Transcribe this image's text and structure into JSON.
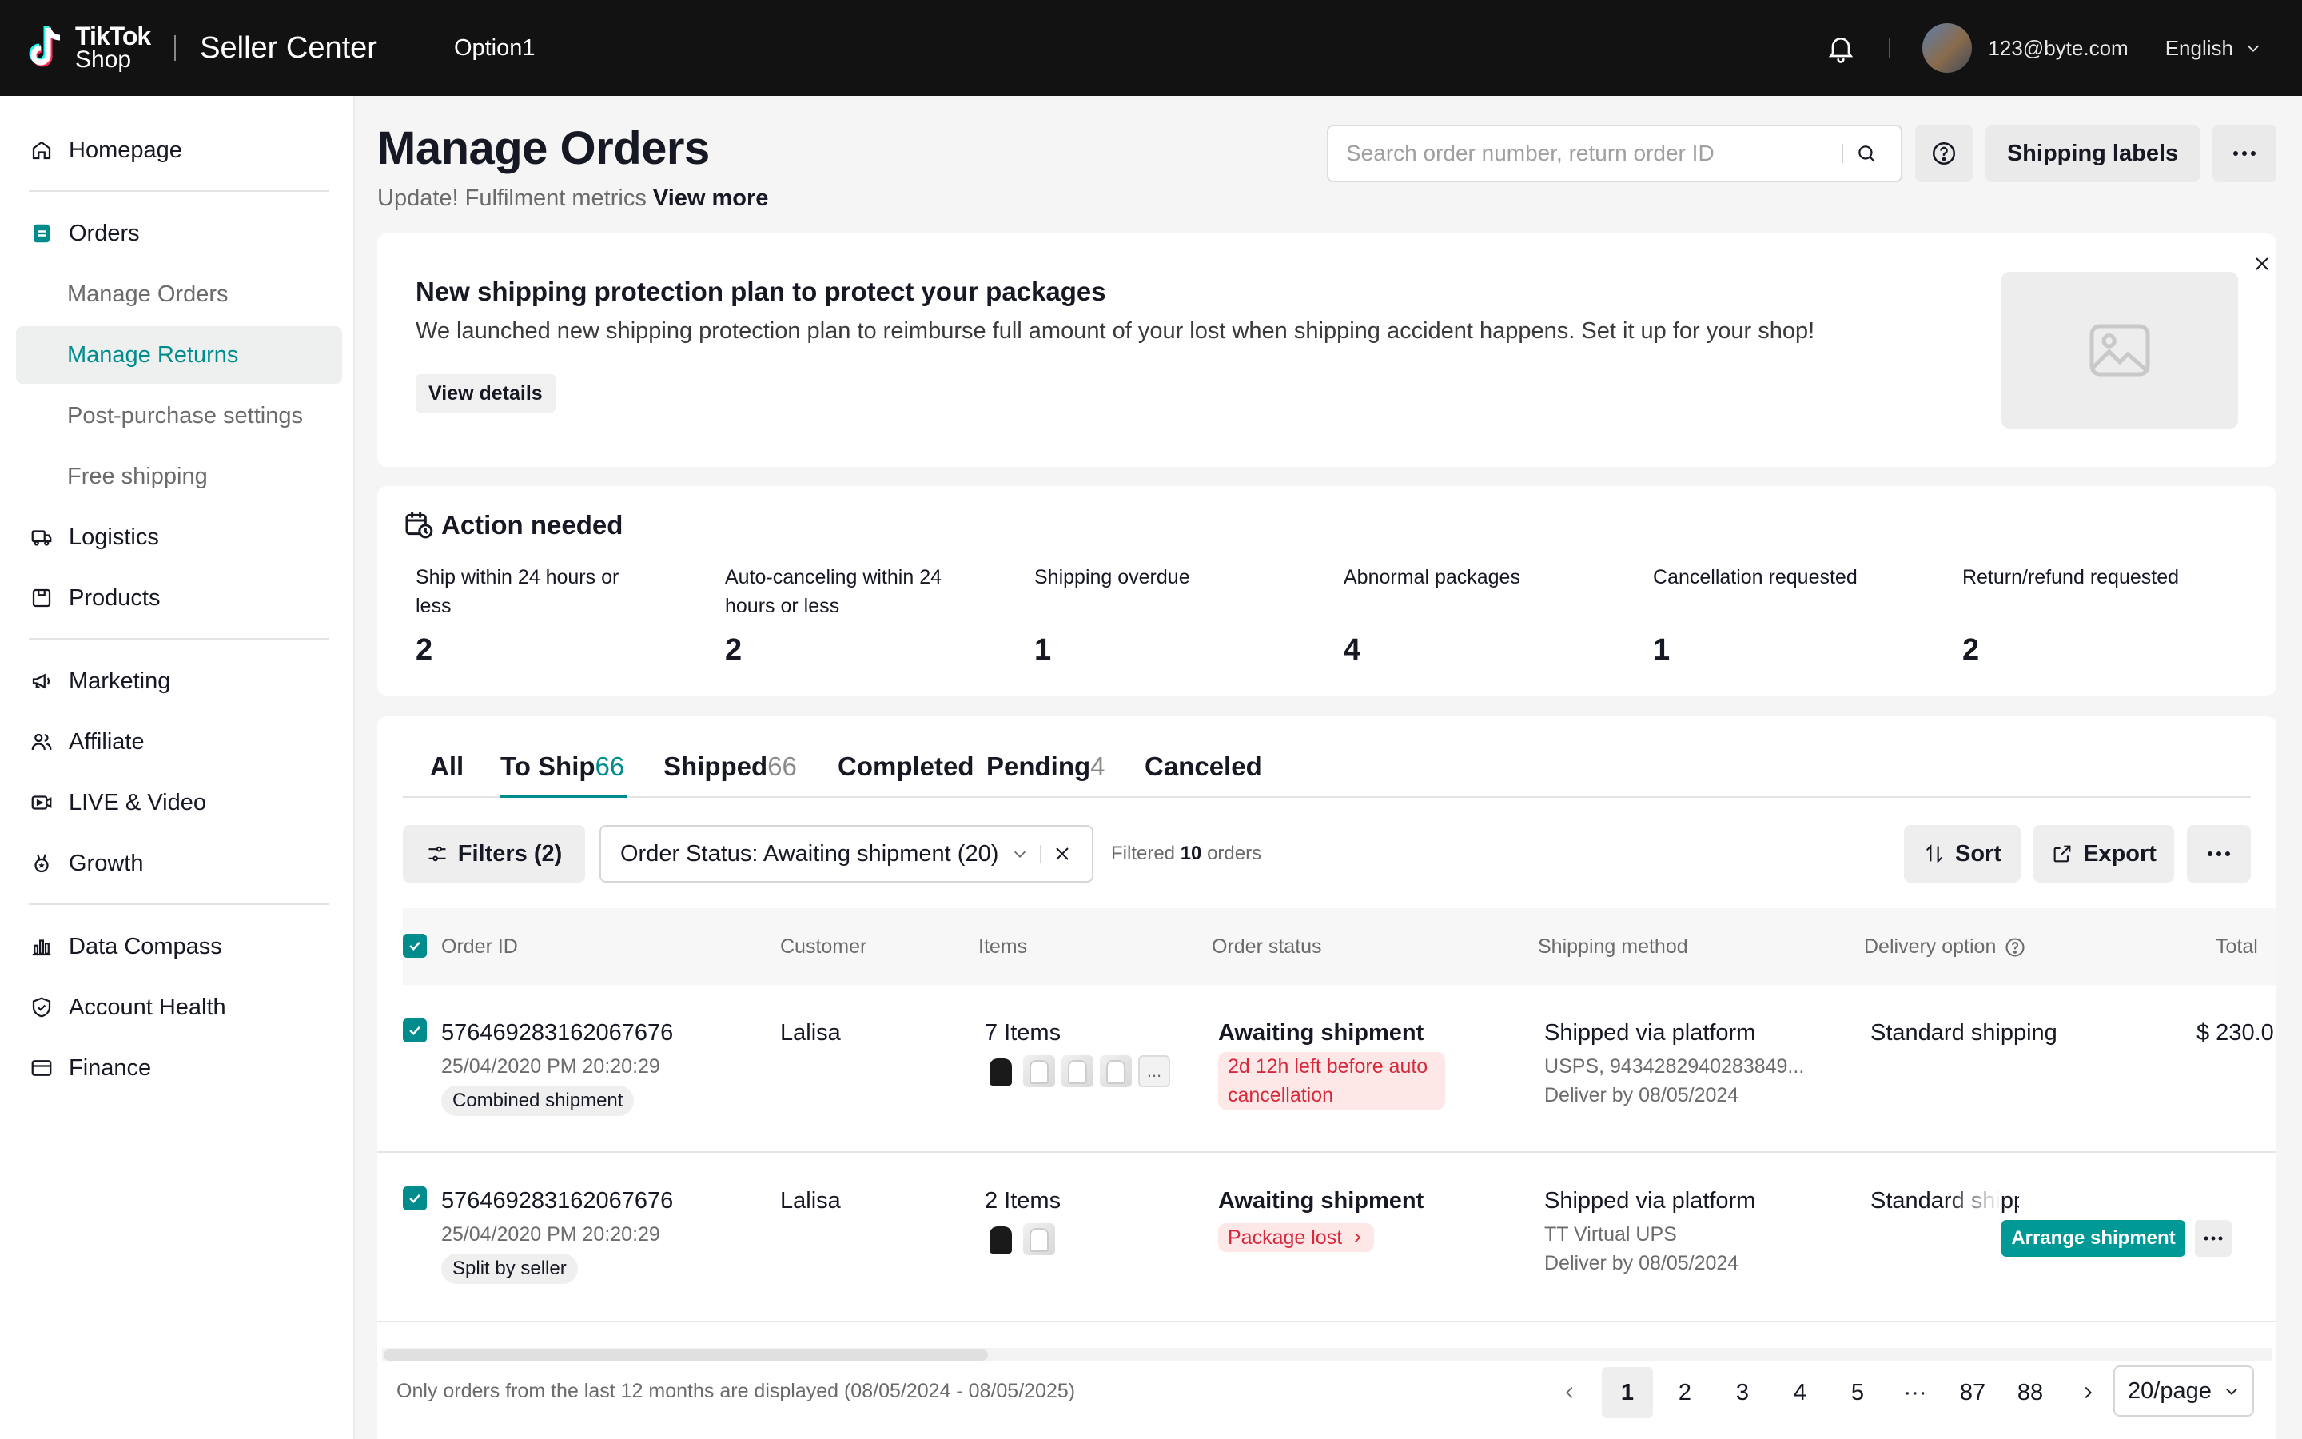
{
  "topbar": {
    "brand_line1": "TikTok",
    "brand_line2": "Shop",
    "product_name": "Seller Center",
    "option": "Option1",
    "user_email": "123@byte.com",
    "language": "English"
  },
  "sidebar": {
    "items": [
      {
        "label": "Homepage",
        "icon": "home-icon"
      },
      {
        "label": "Orders",
        "icon": "orders-icon"
      },
      {
        "label": "Manage Orders",
        "sub": true
      },
      {
        "label": "Manage Returns",
        "sub": true,
        "active": true
      },
      {
        "label": "Post-purchase settings",
        "sub": true
      },
      {
        "label": "Free shipping",
        "sub": true
      },
      {
        "label": "Logistics",
        "icon": "truck-icon"
      },
      {
        "label": "Products",
        "icon": "box-icon"
      },
      {
        "label": "Marketing",
        "icon": "megaphone-icon"
      },
      {
        "label": "Affiliate",
        "icon": "people-icon"
      },
      {
        "label": "LIVE & Video",
        "icon": "video-icon"
      },
      {
        "label": "Growth",
        "icon": "medal-icon"
      },
      {
        "label": "Data Compass",
        "icon": "bar-chart-icon"
      },
      {
        "label": "Account Health",
        "icon": "shield-icon"
      },
      {
        "label": "Finance",
        "icon": "card-icon"
      }
    ]
  },
  "header": {
    "title": "Manage Orders",
    "subtitle": "Update! Fulfilment metrics",
    "subtitle_link": "View more",
    "search_placeholder": "Search order number, return order ID",
    "shipping_labels": "Shipping labels"
  },
  "banner": {
    "title": "New shipping protection plan to protect your packages",
    "description": "We launched new shipping protection plan to reimburse full amount of your lost when shipping accident happens. Set it up for your shop!",
    "button": "View details"
  },
  "action_needed": {
    "title": "Action needed",
    "metrics": [
      {
        "label": "Ship within 24 hours or less",
        "value": "2"
      },
      {
        "label": "Auto-canceling within 24 hours or less",
        "value": "2"
      },
      {
        "label": "Shipping overdue",
        "value": "1"
      },
      {
        "label": "Abnormal packages",
        "value": "4"
      },
      {
        "label": "Cancellation requested",
        "value": "1"
      },
      {
        "label": "Return/refund requested",
        "value": "2"
      }
    ]
  },
  "tabs": [
    {
      "label": "All",
      "count": ""
    },
    {
      "label": "To Ship",
      "count": "66",
      "active": true
    },
    {
      "label": "Shipped",
      "count": "66"
    },
    {
      "label": "Completed",
      "count": ""
    },
    {
      "label": "Pending",
      "count": "4"
    },
    {
      "label": "Canceled",
      "count": ""
    }
  ],
  "toolbar": {
    "filters": "Filters (2)",
    "status_filter": "Order Status: Awaiting shipment (20)",
    "filtered_prefix": "Filtered",
    "filtered_count": "10",
    "filtered_suffix": "orders",
    "sort": "Sort",
    "export": "Export"
  },
  "table": {
    "columns": [
      "Order ID",
      "Customer",
      "Items",
      "Order status",
      "Shipping method",
      "Delivery option",
      "Total"
    ],
    "rows": [
      {
        "order_id": "576469283162067676",
        "date": "25/04/2020 PM 20:20:29",
        "tag": "Combined shipment",
        "customer": "Lalisa",
        "items": "7 Items",
        "more_items": "...",
        "status": "Awaiting shipment",
        "status_note": "2d 12h left before auto cancellation",
        "shipping": "Shipped via platform",
        "carrier": "USPS, 9434282940283849...",
        "deliver_by": "Deliver by 08/05/2024",
        "delivery_option": "Standard shipping",
        "total": "$ 230.0"
      },
      {
        "order_id": "576469283162067676",
        "date": "25/04/2020 PM 20:20:29",
        "tag": "Split by seller",
        "customer": "Lalisa",
        "items": "2 Items",
        "status": "Awaiting shipment",
        "status_note": "Package lost",
        "shipping": "Shipped via platform",
        "carrier": "TT Virtual UPS",
        "deliver_by": "Deliver by 08/05/2024",
        "delivery_option": "Standard shipping",
        "action": "Arrange shipment"
      }
    ]
  },
  "footer": {
    "note": "Only orders from the last 12 months are displayed (08/05/2024 - 08/05/2025)",
    "pages": [
      "1",
      "2",
      "3",
      "4",
      "5",
      "···",
      "87",
      "88"
    ],
    "page_size": "20/page"
  },
  "colors": {
    "accent": "#008c8c",
    "topbar": "#121212",
    "danger": "#d8293c",
    "danger_bg": "#fde7e7"
  }
}
